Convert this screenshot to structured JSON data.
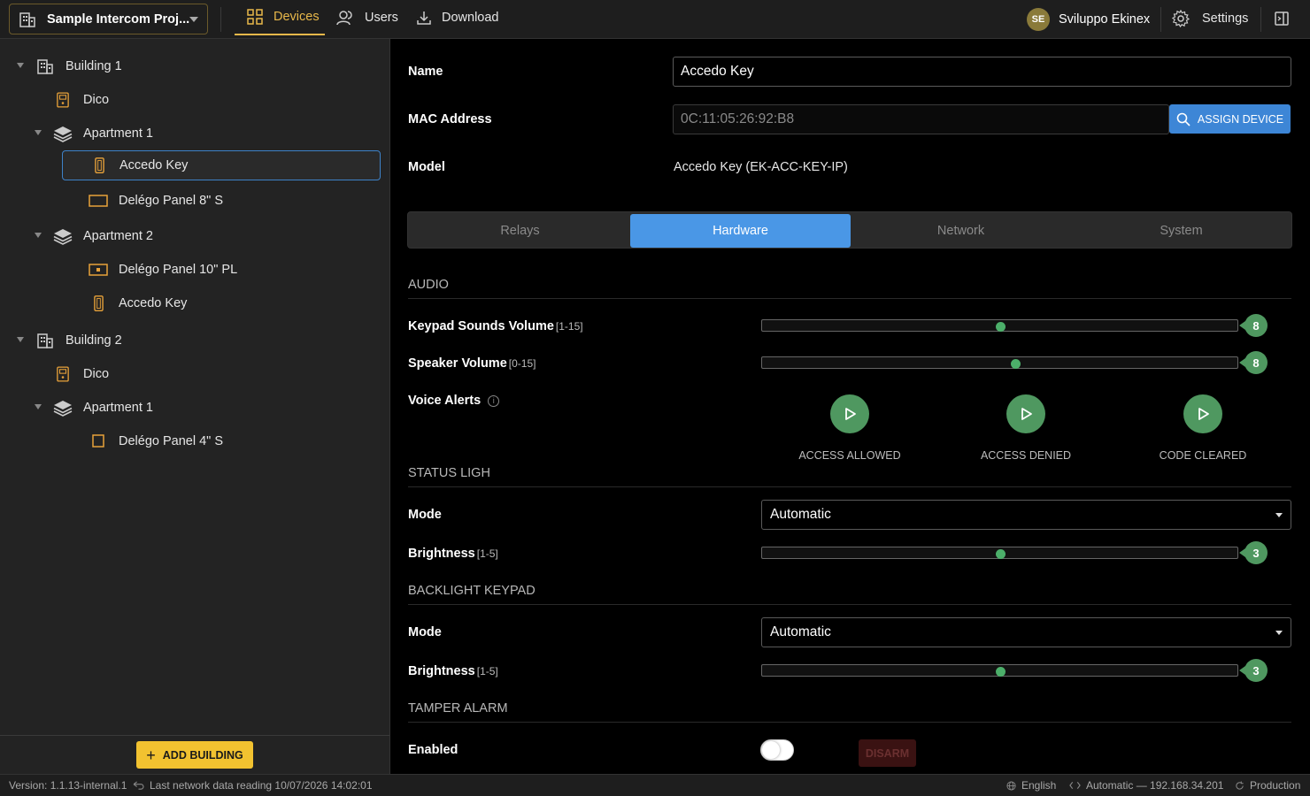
{
  "header": {
    "project": "Sample Intercom Proj...",
    "nav": {
      "devices": "Devices",
      "users": "Users",
      "download": "Download"
    },
    "user": {
      "initials": "SE",
      "name": "Sviluppo Ekinex"
    },
    "settings": "Settings"
  },
  "tree": {
    "building1": "Building 1",
    "b1_dico": "Dico",
    "b1_apt1": "Apartment 1",
    "b1_apt1_key": "Accedo Key",
    "b1_apt1_panel": "Delégo Panel 8\" S",
    "b1_apt2": "Apartment 2",
    "b1_apt2_panel": "Delégo Panel 10\" PL",
    "b1_apt2_key": "Accedo Key",
    "building2": "Building 2",
    "b2_dico": "Dico",
    "b2_apt1": "Apartment 1",
    "b2_apt1_panel": "Delégo Panel 4\" S"
  },
  "add_building": "ADD BUILDING",
  "device": {
    "name_label": "Name",
    "name_value": "Accedo Key",
    "mac_label": "MAC Address",
    "mac_placeholder": "0C:11:05:26:92:B8",
    "assign_label": "ASSIGN DEVICE",
    "model_label": "Model",
    "model_value": "Accedo Key (EK-ACC-KEY-IP)"
  },
  "tabs": [
    "Relays",
    "Hardware",
    "Network",
    "System"
  ],
  "audio": {
    "title": "AUDIO",
    "keypad_label": "Keypad Sounds Volume",
    "keypad_range": "[1-15]",
    "keypad_value": "8",
    "keypad_fraction": 0.5,
    "speaker_label": "Speaker Volume",
    "speaker_range": "[0-15]",
    "speaker_value": "8",
    "speaker_fraction": 0.533,
    "voice_label": "Voice Alerts",
    "voice_info": "i",
    "alerts": [
      "ACCESS ALLOWED",
      "ACCESS DENIED",
      "CODE CLEARED"
    ]
  },
  "status_light": {
    "title": "STATUS LIGH",
    "mode_label": "Mode",
    "mode_value": "Automatic",
    "brightness_label": "Brightness",
    "brightness_range": "[1-5]",
    "brightness_value": "3",
    "brightness_fraction": 0.5
  },
  "backlight": {
    "title": "BACKLIGHT KEYPAD",
    "mode_label": "Mode",
    "mode_value": "Automatic",
    "brightness_label": "Brightness",
    "brightness_range": "[1-5]",
    "brightness_value": "3",
    "brightness_fraction": 0.5
  },
  "tamper": {
    "title": "TAMPER ALARM",
    "enabled_label": "Enabled",
    "enabled": false,
    "disarm_label": "DISARM"
  },
  "status_bar": {
    "version": "Version: 1.1.13-internal.1",
    "last_reading": "Last network data reading 10/07/2026 14:02:01",
    "language": "English",
    "network": "Automatic — 192.168.34.201",
    "environment": "Production"
  },
  "colors": {
    "accent": "#e8b84a",
    "primary": "#3d86d6",
    "success": "#4f9860"
  }
}
